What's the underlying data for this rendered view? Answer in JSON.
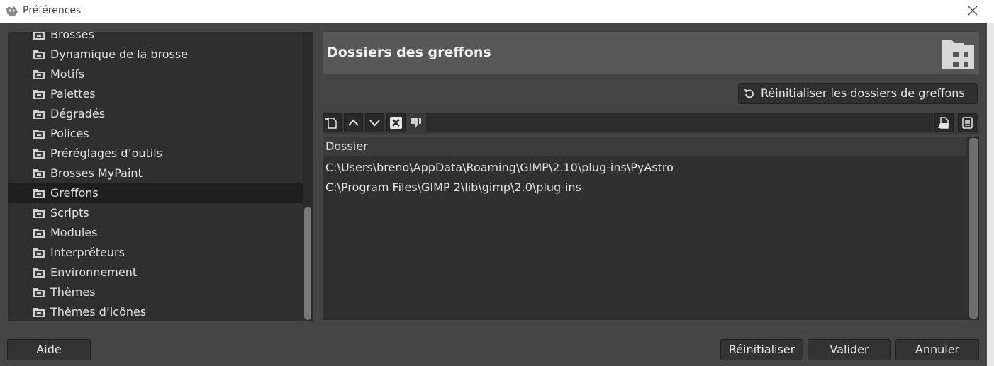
{
  "window": {
    "title": "Préférences"
  },
  "sidebar": {
    "items": [
      {
        "label": "Brosses",
        "icon": "brush-folder-icon",
        "selected": false
      },
      {
        "label": "Dynamique de la brosse",
        "icon": "dynamics-folder-icon",
        "selected": false
      },
      {
        "label": "Motifs",
        "icon": "pattern-folder-icon",
        "selected": false
      },
      {
        "label": "Palettes",
        "icon": "palette-folder-icon",
        "selected": false
      },
      {
        "label": "Dégradés",
        "icon": "gradient-folder-icon",
        "selected": false
      },
      {
        "label": "Polices",
        "icon": "font-folder-icon",
        "selected": false
      },
      {
        "label": "Préréglages d’outils",
        "icon": "tool-preset-folder-icon",
        "selected": false
      },
      {
        "label": "Brosses MyPaint",
        "icon": "mypaint-folder-icon",
        "selected": false
      },
      {
        "label": "Greffons",
        "icon": "plugin-folder-icon",
        "selected": true
      },
      {
        "label": "Scripts",
        "icon": "script-folder-icon",
        "selected": false
      },
      {
        "label": "Modules",
        "icon": "module-folder-icon",
        "selected": false
      },
      {
        "label": "Interpréteurs",
        "icon": "interpreter-folder-icon",
        "selected": false
      },
      {
        "label": "Environnement",
        "icon": "environment-folder-icon",
        "selected": false
      },
      {
        "label": "Thèmes",
        "icon": "theme-folder-icon",
        "selected": false
      },
      {
        "label": "Thèmes d’icônes",
        "icon": "icon-theme-folder-icon",
        "selected": false
      }
    ]
  },
  "header": {
    "title": "Dossiers des greffons"
  },
  "reset_folders_label": "Réinitialiser les dossiers de greffons",
  "folder_table": {
    "column": "Dossier",
    "rows": [
      "C:\\Users\\breno\\AppData\\Roaming\\GIMP\\2.10\\plug-ins\\PyAstro",
      "C:\\Program Files\\GIMP 2\\lib\\gimp\\2.0\\plug-ins"
    ]
  },
  "buttons": {
    "help": "Aide",
    "reset": "Réinitialiser",
    "ok": "Valider",
    "cancel": "Annuler"
  },
  "colors": {
    "background": "#454545",
    "panel": "#2f2f2f",
    "selected": "#1f1f1f"
  }
}
